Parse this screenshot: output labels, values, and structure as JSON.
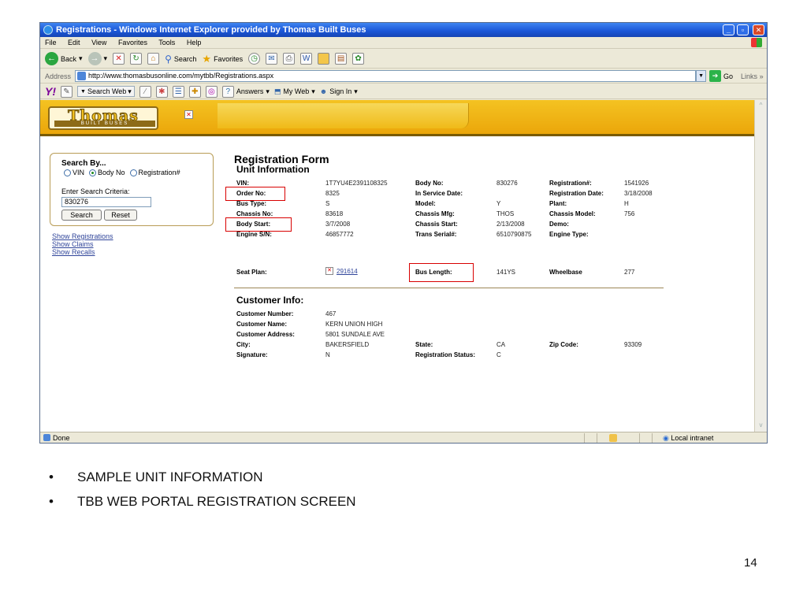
{
  "window": {
    "title": "Registrations - Windows Internet Explorer provided by Thomas Built Buses",
    "menu": [
      "File",
      "Edit",
      "View",
      "Favorites",
      "Tools",
      "Help"
    ]
  },
  "toolbar": {
    "back": "Back",
    "search": "Search",
    "favorites": "Favorites"
  },
  "addressbar": {
    "label": "Address",
    "url": "http://www.thomasbusonline.com/mytbb/Registrations.aspx",
    "go": "Go",
    "links": "Links"
  },
  "yahoo": {
    "logo": "Y!",
    "search_web": "Search Web",
    "answers": "Answers",
    "my_web": "My Web",
    "sign_in": "Sign In"
  },
  "banner": {
    "logo_word": "Thomas",
    "logo_sub": "BUILT BUSES"
  },
  "search": {
    "heading": "Search By...",
    "options": [
      "VIN",
      "Body No",
      "Registration#"
    ],
    "selected": "Body No",
    "criteria_label": "Enter Search Criteria:",
    "criteria_value": "830276",
    "search_btn": "Search",
    "reset_btn": "Reset",
    "links": [
      "Show Registrations",
      "Show Claims",
      "Show Recalls"
    ]
  },
  "form": {
    "title": "Registration Form",
    "unit_heading": "Unit Information",
    "unit": {
      "vin_label": "VIN:",
      "vin": "1T7YU4E2391108325",
      "body_no_label": "Body No:",
      "body_no": "830276",
      "reg_no_label": "Registration#:",
      "reg_no": "1541926",
      "order_no_label": "Order No:",
      "order_no": "8325",
      "in_service_label": "In Service Date:",
      "in_service": "",
      "reg_date_label": "Registration Date:",
      "reg_date": "3/18/2008",
      "bus_type_label": "Bus Type:",
      "bus_type": "S",
      "model_label": "Model:",
      "model": "Y",
      "plant_label": "Plant:",
      "plant": "H",
      "chassis_no_label": "Chassis No:",
      "chassis_no": "83618",
      "chassis_mfg_label": "Chassis Mfg:",
      "chassis_mfg": "THOS",
      "chassis_model_label": "Chassis Model:",
      "chassis_model": "756",
      "body_start_label": "Body Start:",
      "body_start": "3/7/2008",
      "chassis_start_label": "Chassis Start:",
      "chassis_start": "2/13/2008",
      "demo_label": "Demo:",
      "demo": "",
      "engine_sn_label": "Engine S/N:",
      "engine_sn": "46857772",
      "trans_serial_label": "Trans Serial#:",
      "trans_serial": "6510790875",
      "engine_type_label": "Engine Type:",
      "engine_type": "",
      "seat_plan_label": "Seat Plan:",
      "seat_plan": "291614",
      "bus_length_label": "Bus Length:",
      "bus_length": "141YS",
      "wheelbase_label": "Wheelbase",
      "wheelbase": "277"
    },
    "customer_heading": "Customer Info:",
    "customer": {
      "number_label": "Customer Number:",
      "number": "467",
      "name_label": "Customer Name:",
      "name": "KERN UNION HIGH",
      "address_label": "Customer Address:",
      "address": "5801 SUNDALE AVE",
      "city_label": "City:",
      "city": "BAKERSFIELD",
      "state_label": "State:",
      "state": "CA",
      "zip_label": "Zip Code:",
      "zip": "93309",
      "signature_label": "Signature:",
      "signature": "N",
      "reg_status_label": "Registration Status:",
      "reg_status": "C"
    }
  },
  "statusbar": {
    "status": "Done",
    "zone": "Local intranet"
  },
  "slide": {
    "bullets": [
      "SAMPLE UNIT INFORMATION",
      "TBB WEB PORTAL REGISTRATION SCREEN"
    ],
    "page_number": "14"
  },
  "colors": {
    "highlight": "#d80000",
    "banner": "#f0b414",
    "title_bar": "#1a55d6"
  }
}
